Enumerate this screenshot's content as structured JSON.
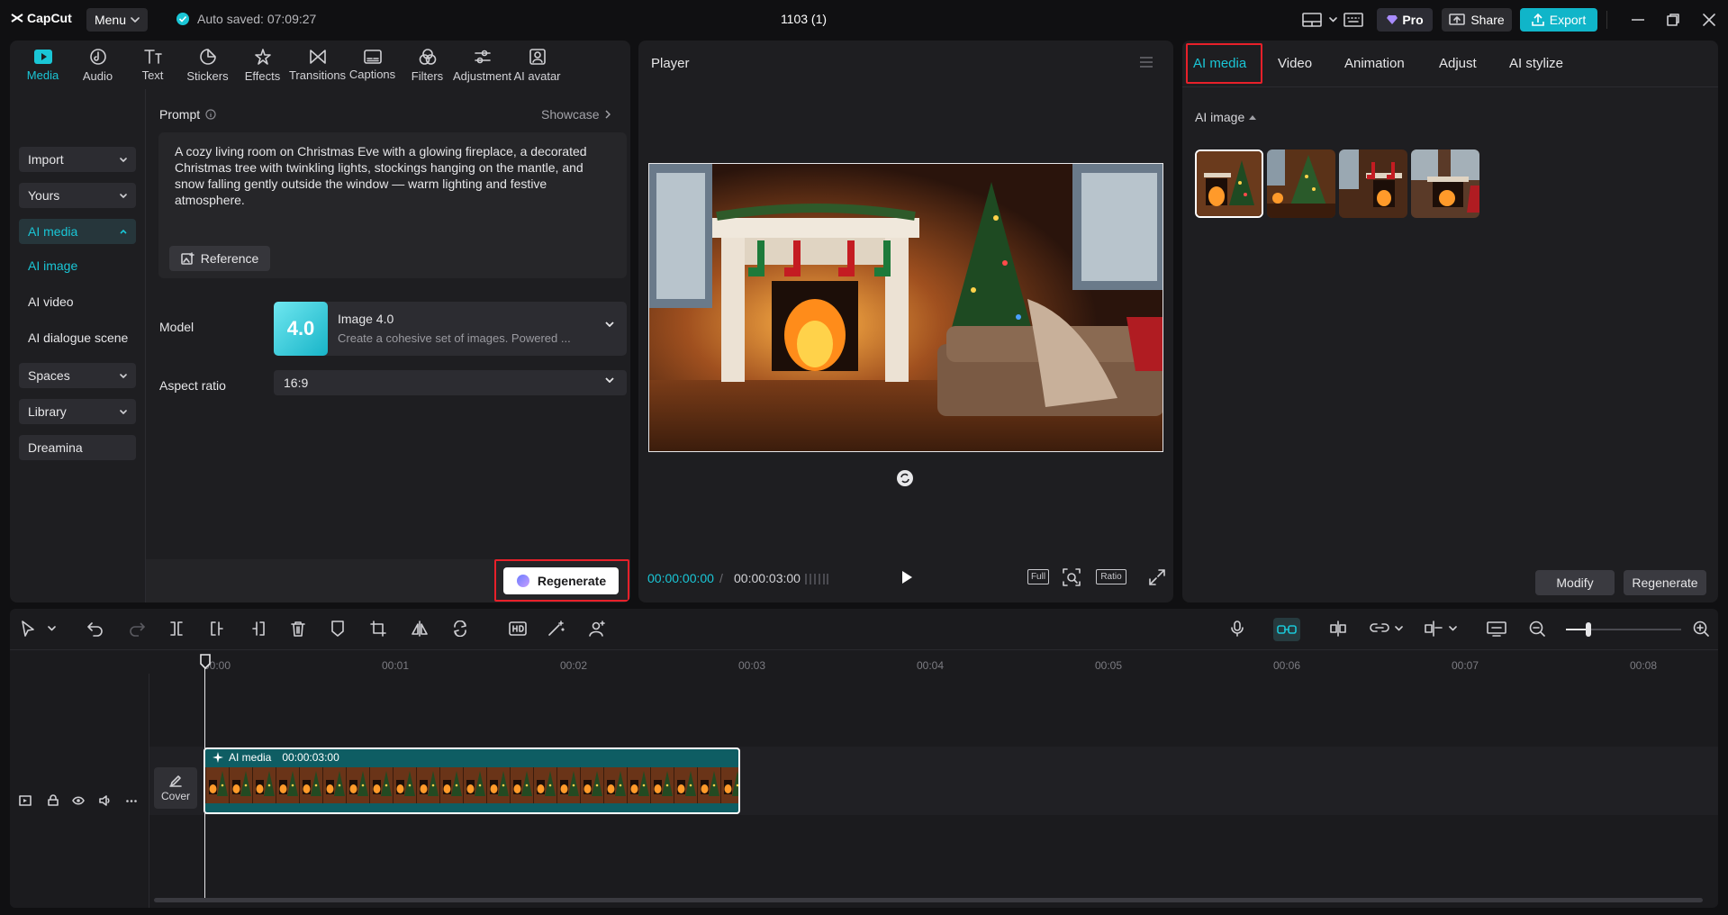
{
  "app": {
    "logo": "CapCut",
    "menu_label": "Menu",
    "autosave": "Auto saved: 07:09:27",
    "project_title": "1103 (1)",
    "pro_label": "Pro",
    "share_label": "Share",
    "export_label": "Export"
  },
  "toolbar": {
    "items": [
      {
        "label": "Media",
        "icon": "media-icon"
      },
      {
        "label": "Audio",
        "icon": "audio-icon"
      },
      {
        "label": "Text",
        "icon": "text-icon"
      },
      {
        "label": "Stickers",
        "icon": "stickers-icon"
      },
      {
        "label": "Effects",
        "icon": "effects-icon"
      },
      {
        "label": "Transitions",
        "icon": "transitions-icon"
      },
      {
        "label": "Captions",
        "icon": "captions-icon"
      },
      {
        "label": "Filters",
        "icon": "filters-icon"
      },
      {
        "label": "Adjustment",
        "icon": "adjustment-icon"
      },
      {
        "label": "AI avatar",
        "icon": "ai-avatar-icon"
      }
    ],
    "active": "Media"
  },
  "sidebar": {
    "items": [
      {
        "label": "Import"
      },
      {
        "label": "Yours"
      },
      {
        "label": "AI media"
      },
      {
        "label": "AI image"
      },
      {
        "label": "AI video"
      },
      {
        "label": "AI dialogue scene"
      },
      {
        "label": "Spaces"
      },
      {
        "label": "Library"
      },
      {
        "label": "Dreamina"
      }
    ]
  },
  "prompt": {
    "label": "Prompt",
    "showcase": "Showcase",
    "text": "A cozy living room on Christmas Eve with a glowing fireplace, a decorated Christmas tree with twinkling lights, stockings hanging on the mantle, and snow falling gently outside the window — warm lighting and festive atmosphere.",
    "reference_label": "Reference"
  },
  "model": {
    "label": "Model",
    "badge": "4.0",
    "name": "Image 4.0",
    "description": "Create a cohesive set of images. Powered ..."
  },
  "aspect": {
    "label": "Aspect ratio",
    "value": "16:9"
  },
  "left_footer": {
    "regenerate_label": "Regenerate"
  },
  "player": {
    "title": "Player",
    "time_current": "00:00:00:00",
    "time_total": "00:00:03:00",
    "controls": [
      "Full",
      "Ratio"
    ]
  },
  "right_panel": {
    "tabs": [
      "AI media",
      "Video",
      "Animation",
      "Adjust",
      "AI stylize"
    ],
    "active_tab": "AI media",
    "section_label": "AI image",
    "modify_label": "Modify",
    "regenerate_label": "Regenerate",
    "thumb_count_selected": 1
  },
  "timeline": {
    "ticks": [
      "00:00",
      "00:01",
      "00:02",
      "00:03",
      "00:04",
      "00:05",
      "00:06",
      "00:07",
      "00:08"
    ],
    "cover_label": "Cover",
    "clip_label": "AI media",
    "clip_duration": "00:00:03:00"
  },
  "colors": {
    "accent": "#1ac6d6",
    "highlight": "#e8202a",
    "export": "#10b5c9"
  }
}
